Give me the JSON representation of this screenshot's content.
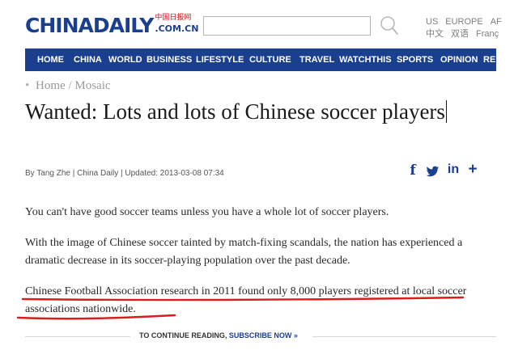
{
  "header": {
    "logo_main": "CHINADAILY",
    "logo_cn": "中国日报网",
    "logo_domain": ".COM.CN",
    "search_placeholder": "",
    "editions_row1": [
      "US",
      "EUROPE",
      "AF"
    ],
    "editions_row2": [
      "中文",
      "双语",
      "Franç"
    ]
  },
  "nav": {
    "items": [
      "HOME",
      "CHINA",
      "WORLD",
      "BUSINESS",
      "LIFESTYLE",
      "CULTURE",
      "TRAVEL",
      "WATCHTHIS",
      "SPORTS",
      "OPINION",
      "RE"
    ]
  },
  "breadcrumb": {
    "bullet": "•",
    "home": "Home",
    "separator": "/",
    "section": "Mosaic"
  },
  "article": {
    "headline": "Wanted: Lots and lots of Chinese soccer players",
    "byline": "By Tang Zhe | China Daily | Updated: 2013-03-08 07:34",
    "paragraphs": [
      "You can't have good soccer teams unless you have a whole lot of soccer players.",
      "With the image of Chinese soccer tainted by match-fixing scandals, the nation has experienced a dramatic decrease in its soccer-playing population over the past decade.",
      "Chinese Football Association research in 2011 found only 8,000 players registered at local soccer associations nationwide."
    ]
  },
  "share": {
    "icons": [
      "facebook-icon",
      "twitter-icon",
      "linkedin-icon",
      "plus-icon"
    ],
    "glyphs": [
      "f",
      "t",
      "in",
      "+"
    ]
  },
  "cta": {
    "lead": "TO CONTINUE READING,",
    "link": "SUBSCRIBE NOW »"
  },
  "colors": {
    "brand_blue": "#1b3f8f",
    "logo_red": "#c8161d",
    "annotation_red": "#d81e1e"
  }
}
